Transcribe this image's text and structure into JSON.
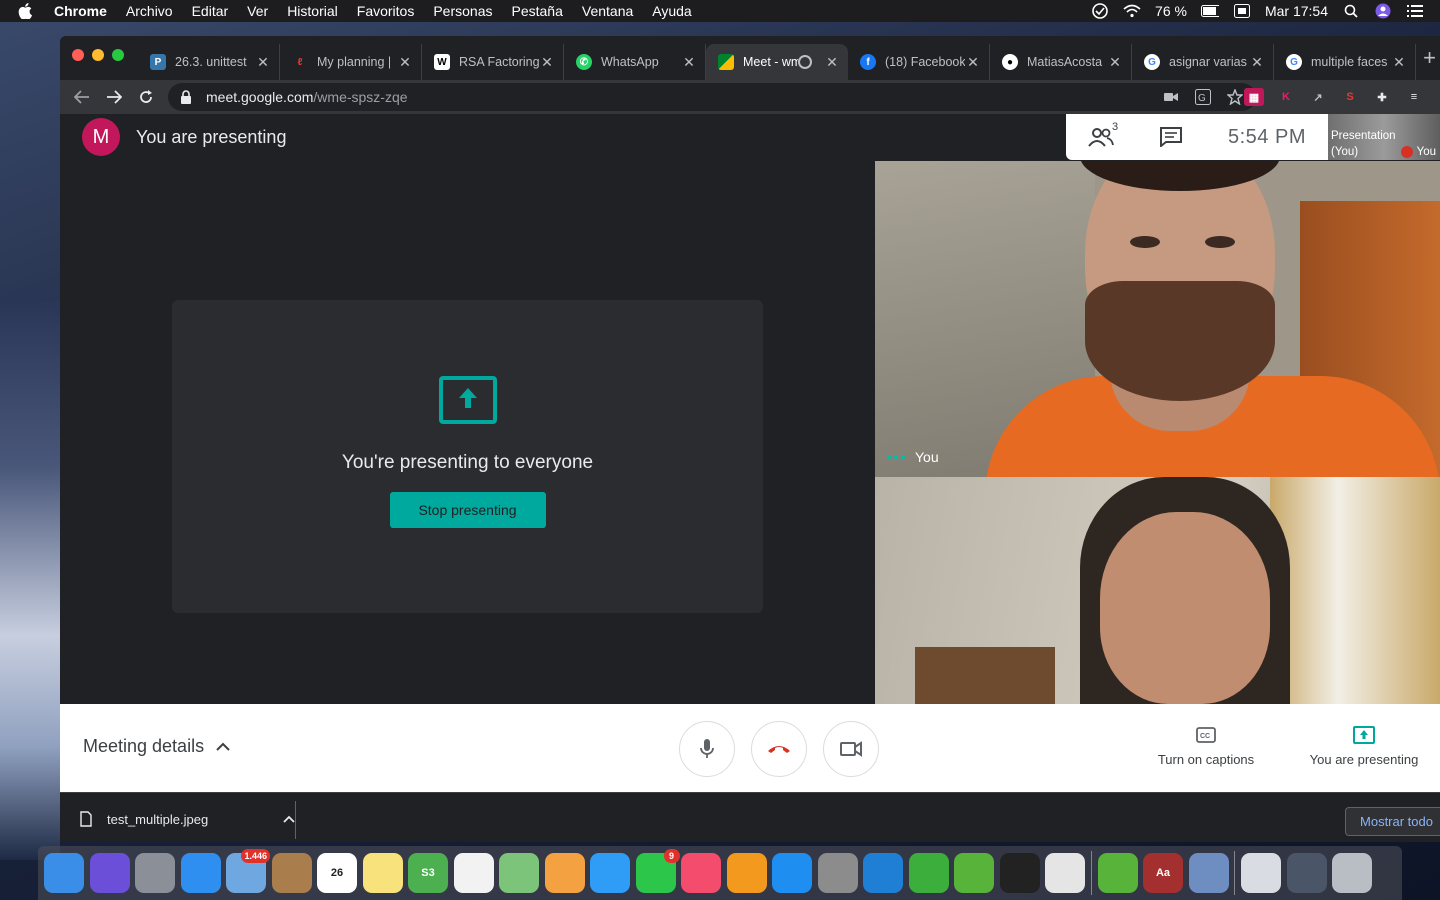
{
  "menubar": {
    "app": "Chrome",
    "items": [
      "Archivo",
      "Editar",
      "Ver",
      "Historial",
      "Favoritos",
      "Personas",
      "Pestaña",
      "Ventana",
      "Ayuda"
    ],
    "battery": "76 %",
    "datetime": "Mar 17:54"
  },
  "tabs": [
    {
      "label": "26.3. unittest",
      "icon": "python-icon",
      "color": "#3776ab"
    },
    {
      "label": "My planning |",
      "icon": "planning-icon",
      "color": "#e53935"
    },
    {
      "label": "RSA Factoring",
      "icon": "wikipedia-icon",
      "color": "#ffffff"
    },
    {
      "label": "WhatsApp",
      "icon": "whatsapp-icon",
      "color": "#25d366"
    },
    {
      "label": "Meet - wm",
      "icon": "meet-icon",
      "color": "#00832d",
      "active": true
    },
    {
      "label": "(18) Facebook",
      "icon": "facebook-icon",
      "color": "#1877f2"
    },
    {
      "label": "MatiasAcosta",
      "icon": "github-icon",
      "color": "#ffffff"
    },
    {
      "label": "asignar varias",
      "icon": "google-icon",
      "color": "#ffffff"
    },
    {
      "label": "multiple faces",
      "icon": "google-icon",
      "color": "#ffffff"
    }
  ],
  "address": {
    "host": "meet.google.com",
    "path": "/wme-spsz-zqe"
  },
  "meet": {
    "avatar_letter": "M",
    "presenting_title": "You are presenting",
    "present_message": "You're presenting to everyone",
    "stop_label": "Stop presenting",
    "participants_count": "3",
    "time": "5:54  PM",
    "thumb_label_1": "Presentation",
    "thumb_label_2": "(You)",
    "thumb_you": "You",
    "self_label": "You",
    "details_label": "Meeting details",
    "captions_label": "Turn on captions",
    "presenting_btn_label": "You are presenting"
  },
  "downloads": {
    "file": "test_multiple.jpeg",
    "show_all": "Mostrar todo"
  },
  "colors": {
    "accent": "#00a99d",
    "hangup": "#d93025",
    "avatar": "#c2185b"
  },
  "dock": [
    {
      "name": "finder-icon",
      "color": "#3b8ee8"
    },
    {
      "name": "siri-icon",
      "color": "#6b4fd8"
    },
    {
      "name": "launchpad-icon",
      "color": "#8a8f98"
    },
    {
      "name": "safari-icon",
      "color": "#2e8ff0"
    },
    {
      "name": "mail-icon",
      "color": "#6fa8e0",
      "badge": "1.446"
    },
    {
      "name": "contacts-icon",
      "color": "#a97d4c"
    },
    {
      "name": "calendar-icon",
      "color": "#ffffff",
      "text": "26"
    },
    {
      "name": "notes-icon",
      "color": "#f7e27b"
    },
    {
      "name": "sims-icon",
      "color": "#4caf50",
      "text": "S3"
    },
    {
      "name": "reminders-icon",
      "color": "#f2f2f2"
    },
    {
      "name": "maps-icon",
      "color": "#7cc47a"
    },
    {
      "name": "photos-icon",
      "color": "#f4a142"
    },
    {
      "name": "messages-icon",
      "color": "#2f9cf5"
    },
    {
      "name": "facetime-icon",
      "color": "#2cc64b",
      "badge": "9"
    },
    {
      "name": "music-icon",
      "color": "#f44c6c"
    },
    {
      "name": "books-icon",
      "color": "#f39a1e"
    },
    {
      "name": "appstore-icon",
      "color": "#1f8ef1"
    },
    {
      "name": "system-preferences-icon",
      "color": "#8c8c8c"
    },
    {
      "name": "vscode-icon",
      "color": "#1e7fd4"
    },
    {
      "name": "sims-plumbob-icon",
      "color": "#3cae3c"
    },
    {
      "name": "utorrent-icon",
      "color": "#57b33a"
    },
    {
      "name": "terminal-icon",
      "color": "#222222"
    },
    {
      "name": "chrome-icon",
      "color": "#e5e5e5"
    },
    {
      "name": "utorrent-web-icon",
      "color": "#57b33a"
    },
    {
      "name": "dictionary-icon",
      "color": "#a32f2f",
      "text": "Aa"
    },
    {
      "name": "preview-icon",
      "color": "#6e8ec2"
    },
    {
      "name": "documents-folder-icon",
      "color": "#d9dde3"
    },
    {
      "name": "downloads-folder-icon",
      "color": "#4a5568"
    },
    {
      "name": "trash-icon",
      "color": "#b9bdc4"
    }
  ]
}
